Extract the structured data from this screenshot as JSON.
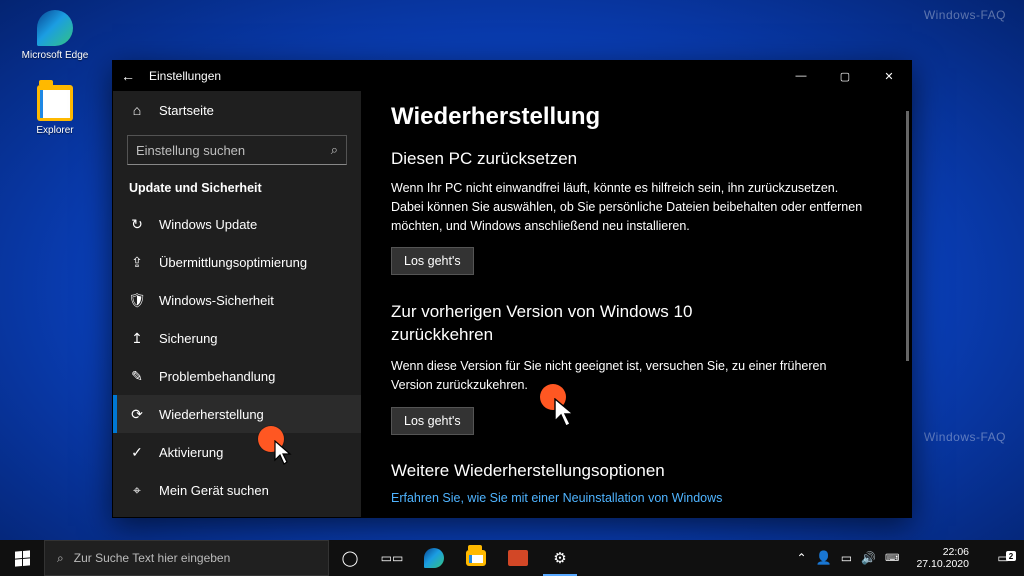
{
  "desktop": {
    "icons": [
      {
        "label": "Microsoft Edge"
      },
      {
        "label": "Explorer"
      }
    ],
    "watermark_top": "Windows-FAQ",
    "watermark_mid": "Windows-FAQ"
  },
  "window": {
    "back_glyph": "←",
    "title": "Einstellungen",
    "min": "—",
    "max": "▢",
    "close": "✕"
  },
  "sidebar": {
    "home_icon": "⌂",
    "home_label": "Startseite",
    "search_placeholder": "Einstellung suchen",
    "search_icon": "⌕",
    "section_title": "Update und Sicherheit",
    "items": [
      {
        "icon": "↻",
        "label": "Windows Update"
      },
      {
        "icon": "⇪",
        "label": "Übermittlungsoptimierung"
      },
      {
        "icon": "🛡",
        "label": "Windows-Sicherheit"
      },
      {
        "icon": "↥",
        "label": "Sicherung"
      },
      {
        "icon": "✎",
        "label": "Problembehandlung"
      },
      {
        "icon": "⟳",
        "label": "Wiederherstellung"
      },
      {
        "icon": "✓",
        "label": "Aktivierung"
      },
      {
        "icon": "⌖",
        "label": "Mein Gerät suchen"
      }
    ]
  },
  "content": {
    "page_title": "Wiederherstellung",
    "section1_title": "Diesen PC zurücksetzen",
    "section1_body": "Wenn Ihr PC nicht einwandfrei läuft, könnte es hilfreich sein, ihn zurückzusetzen. Dabei können Sie auswählen, ob Sie persönliche Dateien beibehalten oder entfernen möchten, und Windows anschließend neu installieren.",
    "section1_button": "Los geht's",
    "section2_title": "Zur vorherigen Version von Windows 10 zurückkehren",
    "section2_body": "Wenn diese Version für Sie nicht geeignet ist, versuchen Sie, zu einer früheren Version zurückzukehren.",
    "section2_button": "Los geht's",
    "section3_title": "Weitere Wiederherstellungsoptionen",
    "section3_link": "Erfahren Sie, wie Sie mit einer Neuinstallation von Windows"
  },
  "taskbar": {
    "search_placeholder": "Zur Suche Text hier eingeben",
    "tray": {
      "time": "22:06",
      "date": "27.10.2020",
      "notif_count": "2"
    }
  }
}
